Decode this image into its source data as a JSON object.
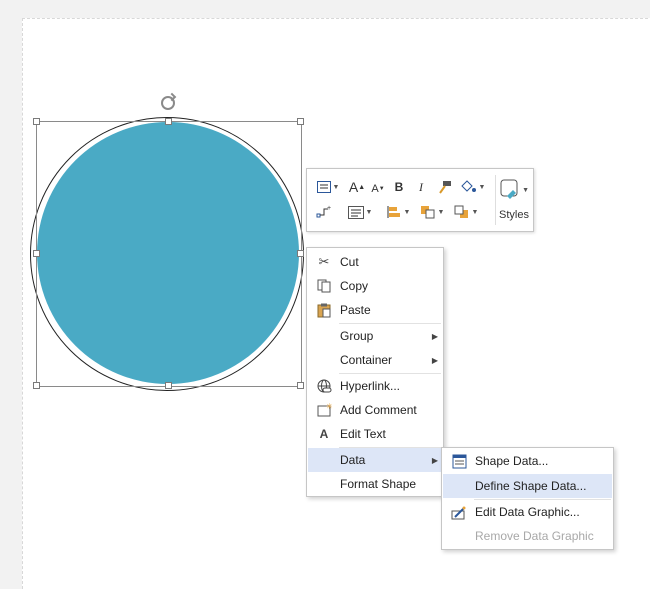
{
  "context_menu": {
    "items": [
      {
        "label": "Cut",
        "icon": "scissors-icon"
      },
      {
        "label": "Copy",
        "icon": "copy-icon"
      },
      {
        "label": "Paste",
        "icon": "clipboard-icon"
      },
      {
        "label": "Group",
        "has_submenu": true
      },
      {
        "label": "Container",
        "has_submenu": true
      },
      {
        "label": "Hyperlink...",
        "icon": "globe-link-icon"
      },
      {
        "label": "Add Comment",
        "icon": "comment-icon"
      },
      {
        "label": "Edit Text",
        "icon": "text-a-icon"
      },
      {
        "label": "Data",
        "has_submenu": true,
        "highlighted": true
      },
      {
        "label": "Format Shape"
      }
    ]
  },
  "data_submenu": {
    "items": [
      {
        "label": "Shape Data...",
        "icon": "shape-data-icon"
      },
      {
        "label": "Define Shape Data...",
        "highlighted": true
      },
      {
        "label": "Edit Data Graphic...",
        "icon": "data-graphic-icon"
      },
      {
        "label": "Remove Data Graphic",
        "disabled": true
      }
    ]
  },
  "mini_toolbar": {
    "styles_label": "Styles",
    "grow_font": "A",
    "shrink_font": "A",
    "bold": "B",
    "italic": "I"
  },
  "colors": {
    "shape_fill": "#4aaac5",
    "menu_highlight": "#dde6f7"
  }
}
